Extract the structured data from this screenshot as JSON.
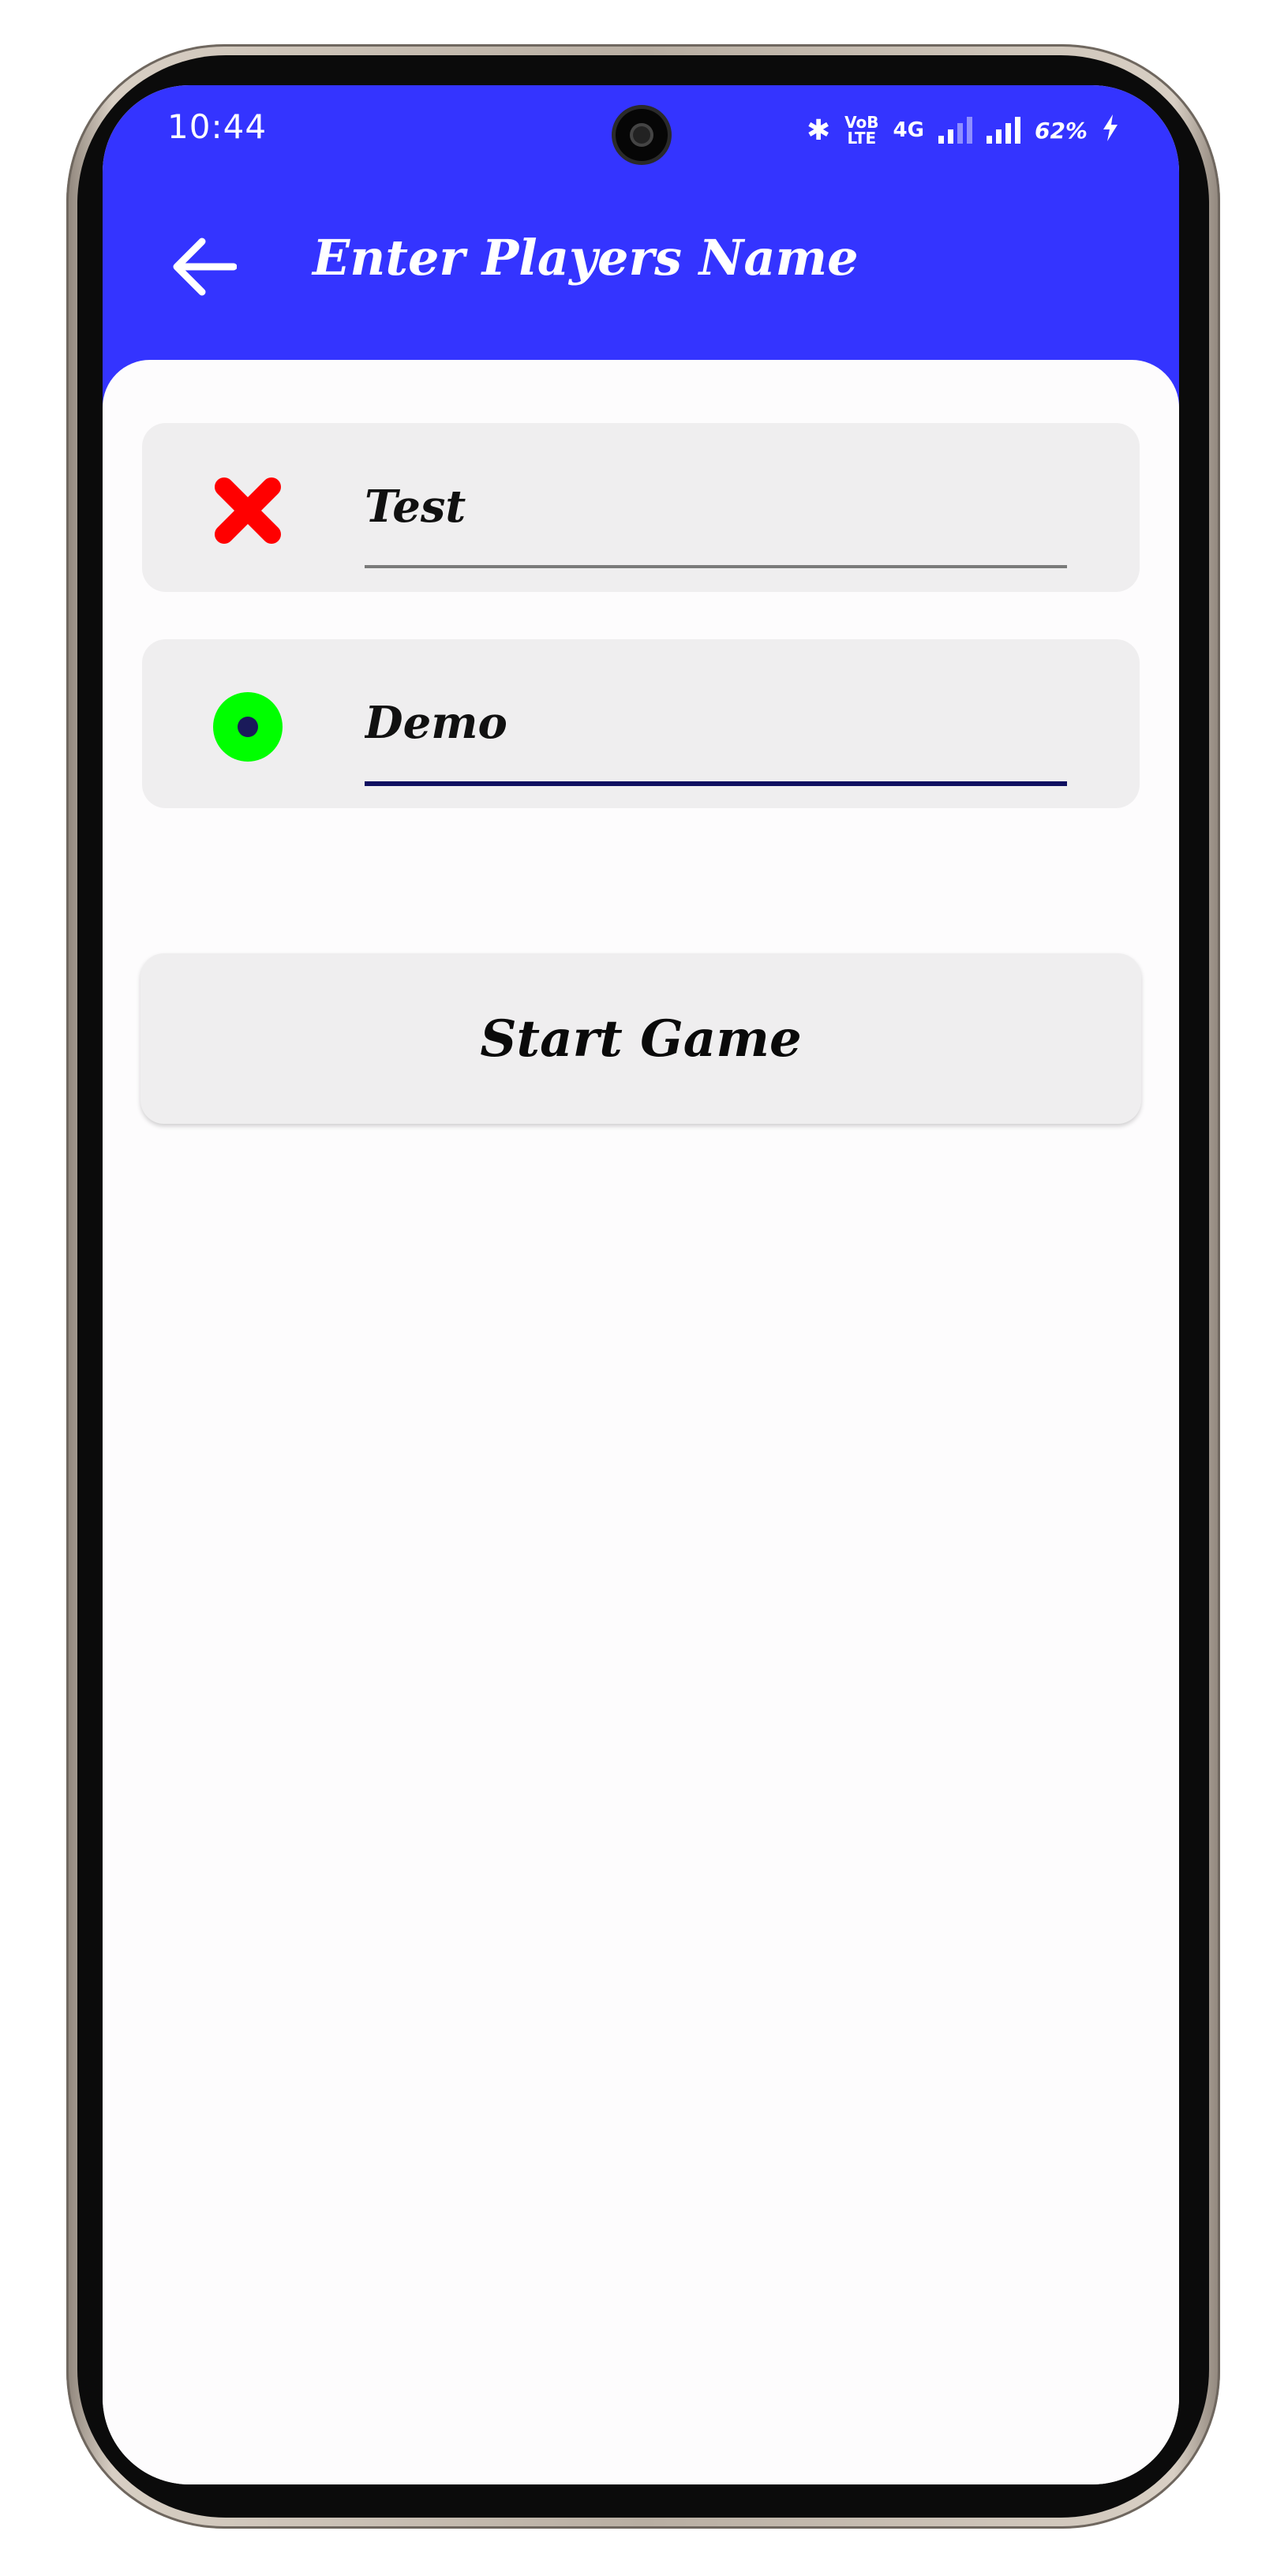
{
  "status_bar": {
    "time": "10:44",
    "icons": [
      "bluetooth-icon",
      "volte-icon",
      "4g-signal-icon",
      "signal-icon",
      "charging-icon"
    ],
    "volte_top": "VoB",
    "volte_bottom": "LTE",
    "network": "4G",
    "battery": "62%"
  },
  "app_bar": {
    "title": "Enter Players Name",
    "back_icon": "arrow-left-icon",
    "color": "#3434ff"
  },
  "players": [
    {
      "symbol": "cross-icon",
      "symbol_color": "#ff0000",
      "name": "Test"
    },
    {
      "symbol": "circle-icon",
      "symbol_color": "#00ff00",
      "name": "Demo"
    }
  ],
  "start_button": {
    "label": "Start Game"
  }
}
